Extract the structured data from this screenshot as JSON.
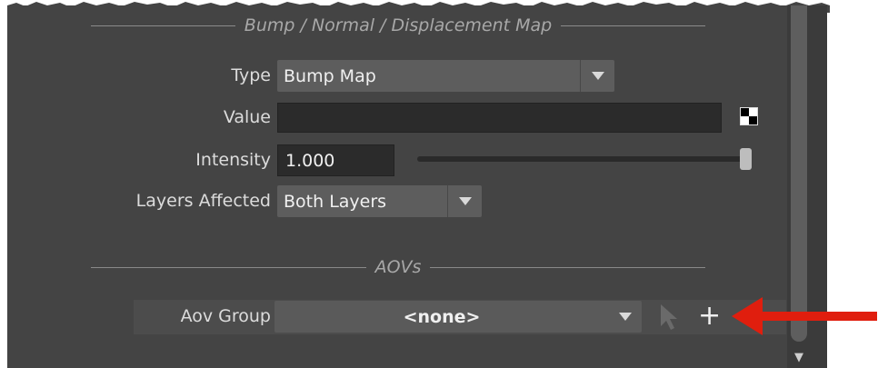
{
  "bump_section": {
    "title": "Bump / Normal / Displacement Map",
    "type_label": "Type",
    "type_value": "Bump Map",
    "value_label": "Value",
    "value_value": "",
    "intensity_label": "Intensity",
    "intensity_value": "1.000",
    "intensity_slider_fraction": 1.0,
    "layers_label": "Layers Affected",
    "layers_value": "Both Layers"
  },
  "aov_section": {
    "title": "AOVs",
    "group_label": "Aov Group",
    "group_value": "<none>",
    "add_symbol": "+"
  },
  "icons": {
    "value_map_button": "checker-icon",
    "select_button": "cursor-arrow-icon",
    "add_button": "plus-icon",
    "callout": "red-arrow-icon",
    "scroll_down": "triangle-down-icon"
  },
  "colors": {
    "panel_bg": "#444444",
    "dropdown_bg": "#5d5d5d",
    "field_bg": "#2b2b2b",
    "callout_red": "#e01e0e"
  }
}
